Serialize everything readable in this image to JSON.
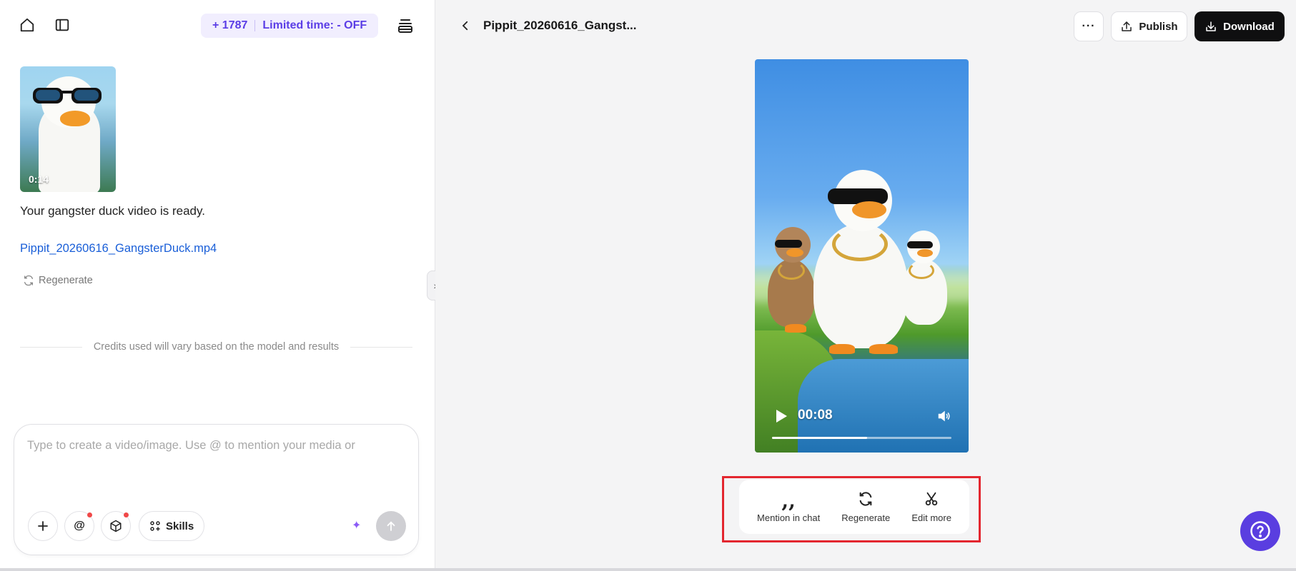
{
  "left_panel": {
    "credits": {
      "amount": "+ 1787",
      "promo": "Limited time: - OFF"
    },
    "message": {
      "thumbnail_duration": "0:14",
      "text": "Your gangster duck video is ready.",
      "file_link": "Pippit_20260616_GangsterDuck.mp4",
      "regenerate_label": "Regenerate"
    },
    "credits_note": "Credits used will vary based on the model and results",
    "composer": {
      "placeholder": "Type to create a video/image. Use @ to mention your media or",
      "skills_label": "Skills"
    }
  },
  "right_panel": {
    "title": "Pippit_20260616_Gangst...",
    "publish_label": "Publish",
    "download_label": "Download",
    "video": {
      "current_time": "00:08",
      "progress": 0.53
    },
    "actions": [
      {
        "label": "Mention in chat",
        "icon": "quote-icon"
      },
      {
        "label": "Regenerate",
        "icon": "refresh-icon"
      },
      {
        "label": "Edit more",
        "icon": "scissors-icon"
      }
    ]
  },
  "colors": {
    "accent": "#5a3ee0",
    "credits_text": "#5b3ee6",
    "link": "#1a5fd8",
    "highlight_border": "#e3262f",
    "download_bg": "#0f0f10"
  }
}
